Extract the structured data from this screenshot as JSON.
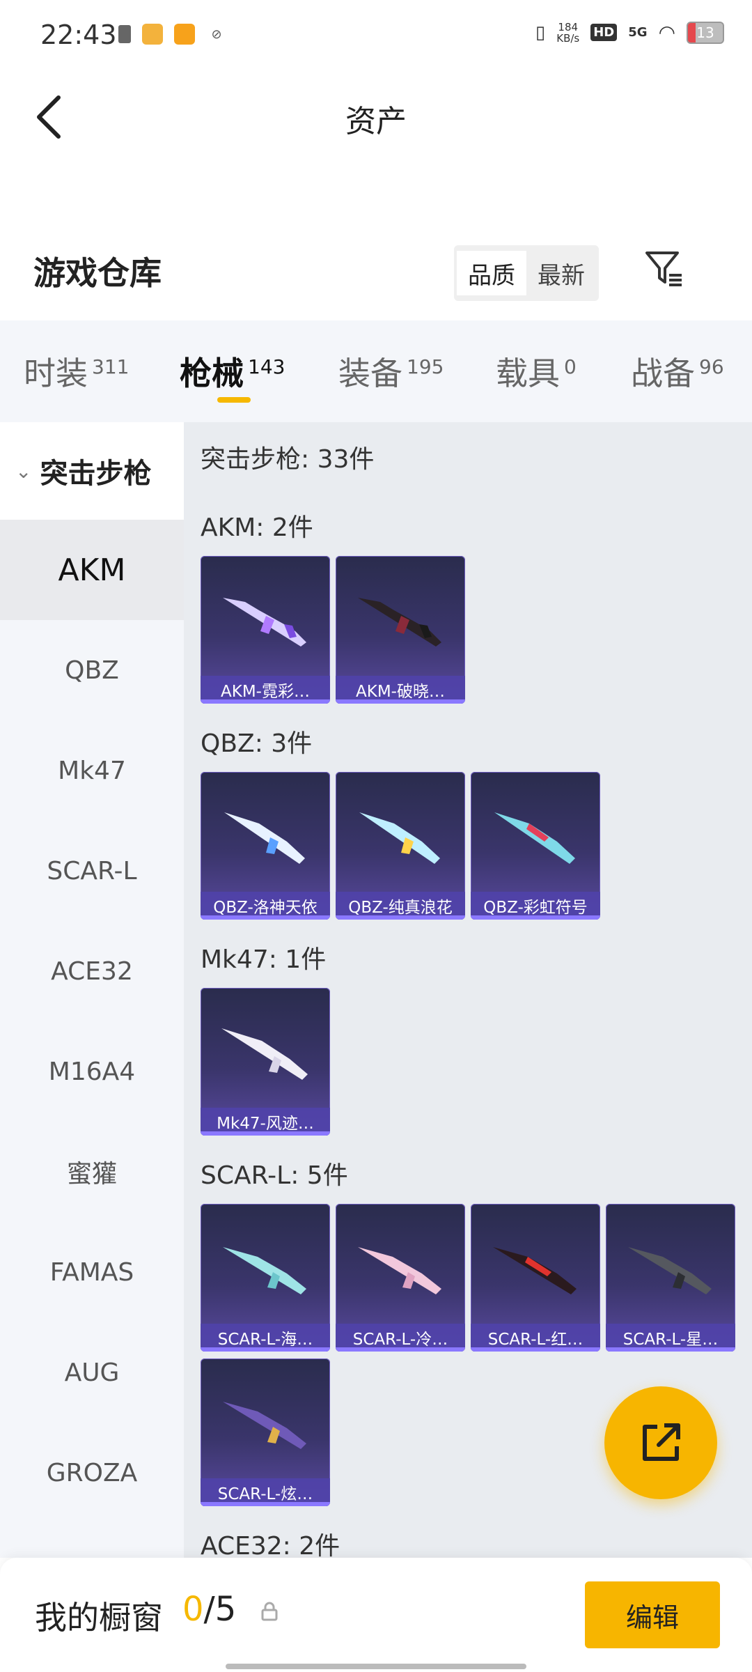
{
  "status": {
    "time": "22:43",
    "net_speed_value": "184",
    "net_speed_unit": "KB/s",
    "hd": "HD",
    "signal": "5G",
    "battery": "13"
  },
  "header": {
    "title": "资产"
  },
  "warehouse": {
    "title": "游戏仓库",
    "sort_options": [
      "品质",
      "最新"
    ],
    "active_sort": "品质"
  },
  "tabs": [
    {
      "label": "时装",
      "count": "311"
    },
    {
      "label": "枪械",
      "count": "143"
    },
    {
      "label": "装备",
      "count": "195"
    },
    {
      "label": "载具",
      "count": "0"
    },
    {
      "label": "战备",
      "count": "96"
    }
  ],
  "active_tab": "枪械",
  "sidebar": {
    "category": "突击步枪",
    "items": [
      "AKM",
      "QBZ",
      "Mk47",
      "SCAR-L",
      "ACE32",
      "M16A4",
      "蜜獾",
      "FAMAS",
      "AUG",
      "GROZA"
    ],
    "active_item": "AKM"
  },
  "content": {
    "total_line": "突击步枪: 33件",
    "sections": [
      {
        "title": "AKM: 2件",
        "items": [
          "AKM-霓彩…",
          "AKM-破晓…"
        ]
      },
      {
        "title": "QBZ: 3件",
        "items": [
          "QBZ-洛神天依",
          "QBZ-纯真浪花",
          "QBZ-彩虹符号"
        ]
      },
      {
        "title": "Mk47: 1件",
        "items": [
          "Mk47-风迹…"
        ]
      },
      {
        "title": "SCAR-L: 5件",
        "items": [
          "SCAR-L-海…",
          "SCAR-L-冷…",
          "SCAR-L-红…",
          "SCAR-L-星…",
          "SCAR-L-炫…"
        ]
      },
      {
        "title": "ACE32: 2件",
        "items": []
      }
    ]
  },
  "showcase": {
    "title": "我的橱窗",
    "current": "0",
    "separator_max": "/5",
    "edit_label": "编辑"
  },
  "colors": {
    "accent": "#f7b500",
    "card_bg": "#3a356b",
    "card_label": "#5042aa"
  }
}
